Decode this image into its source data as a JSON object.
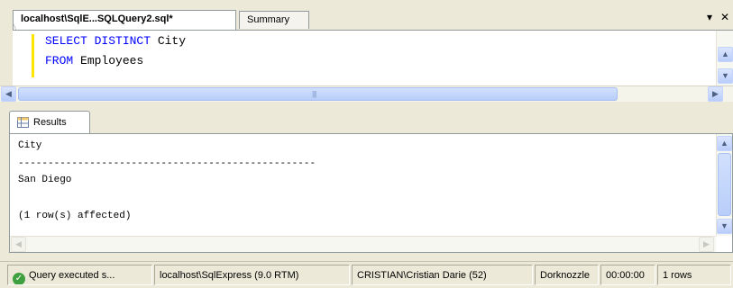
{
  "tabs": {
    "active_label": "localhost\\SqlE...SQLQuery2.sql*",
    "inactive_label": "Summary",
    "dropdown_icon": "dropdown-triangle-icon",
    "close_icon": "close-icon"
  },
  "editor": {
    "line1_kw": "SELECT DISTINCT",
    "line1_rest": " City",
    "line2_kw": "FROM",
    "line2_rest": " Employees"
  },
  "results": {
    "tab_label": "Results",
    "column_header": "City",
    "separator": "--------------------------------------------------",
    "row1": "San Diego",
    "affected": "(1 row(s) affected)"
  },
  "status": {
    "message": "Query executed s...",
    "server": "localhost\\SqlExpress (9.0 RTM)",
    "user": "CRISTIAN\\Cristian Darie (52)",
    "database": "Dorknozzle",
    "elapsed": "00:00:00",
    "rows": "1 rows"
  },
  "colors": {
    "keyword": "#0000ff",
    "margin_marker": "#ffe600",
    "chrome": "#ece9d8"
  }
}
